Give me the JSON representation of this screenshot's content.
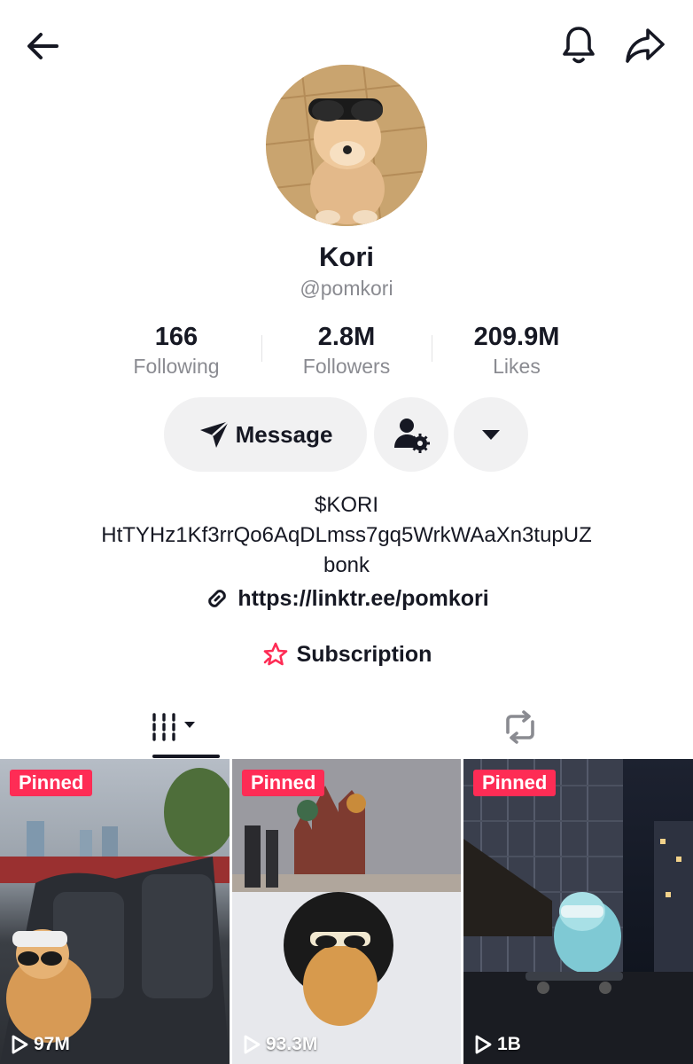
{
  "header": {
    "back_icon": "arrow-left-icon",
    "notification_icon": "bell-icon",
    "share_icon": "share-arrow-icon"
  },
  "profile": {
    "display_name": "Kori",
    "username": "@pomkori",
    "stats": [
      {
        "value": "166",
        "label": "Following"
      },
      {
        "value": "2.8M",
        "label": "Followers"
      },
      {
        "value": "209.9M",
        "label": "Likes"
      }
    ],
    "actions": {
      "message_label": "Message",
      "add_friend_icon": "person-gear-icon",
      "more_icon": "caret-down-icon"
    },
    "bio_lines": [
      "$KORI",
      "HtTYHz1Kf3rrQo6AqDLmss7gq5WrkWAaXn3tupUZ",
      "bonk"
    ],
    "link": "https://linktr.ee/pomkori",
    "subscription_label": "Subscription",
    "accent_color": "#fe2c55"
  },
  "tabs": [
    {
      "name": "videos",
      "icon": "grid-bars-icon",
      "active": true
    },
    {
      "name": "reposts",
      "icon": "repost-icon",
      "active": false
    }
  ],
  "videos": [
    {
      "badge": "Pinned",
      "views": "97M"
    },
    {
      "badge": "Pinned",
      "views": "93.3M"
    },
    {
      "badge": "Pinned",
      "views": "1B"
    }
  ]
}
